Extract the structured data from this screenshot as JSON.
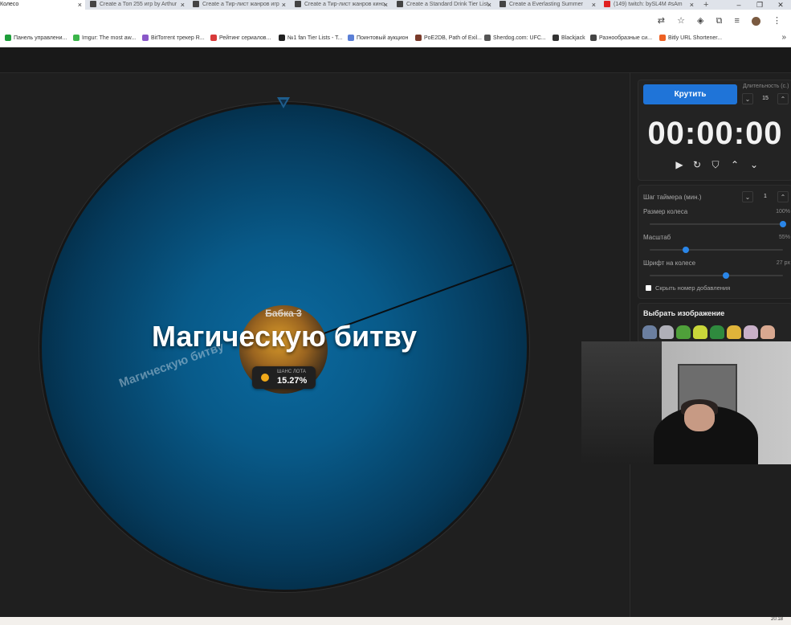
{
  "browser": {
    "tabs": [
      {
        "label": "Колесо",
        "active": true
      },
      {
        "label": "Create a Топ 255 игр by Arthur"
      },
      {
        "label": "Create a Тир-лист жанров игр"
      },
      {
        "label": "Create a Тир-лист жанров кино"
      },
      {
        "label": "Create a Standard Drink Tier List"
      },
      {
        "label": "Create a Everlasting Summer"
      },
      {
        "label": "(149) twitch: bySL4M #sAm"
      }
    ],
    "bookmarks": [
      {
        "label": "Панель управлени...",
        "color": "#1e9e3a"
      },
      {
        "label": "Imgur: The most aw...",
        "color": "#3bb54a"
      },
      {
        "label": "BitTorrent трекер R...",
        "color": "#8a58c8"
      },
      {
        "label": "Рейтинг сериалов...",
        "color": "#d83a3a"
      },
      {
        "label": "№1 fan Tier Lists - T...",
        "color": "#222222"
      },
      {
        "label": "Поинтовый аукцион",
        "color": "#5b7fd6"
      },
      {
        "label": "PoE2DB, Path of Exil...",
        "color": "#7a3b2a"
      },
      {
        "label": "Sherdog.com: UFC...",
        "color": "#555555"
      },
      {
        "label": "Blackjack",
        "color": "#333333"
      },
      {
        "label": "Разнообразные си...",
        "color": "#444444"
      },
      {
        "label": "Bitly URL Shortener...",
        "color": "#ee6123"
      }
    ]
  },
  "wheel": {
    "winner_label": "Магическую битву",
    "segment_label": "Магическую битву",
    "center_name": "Бабка 3",
    "chance_label": "ШАНС ЛОТА",
    "chance_value": "15.27%"
  },
  "controls": {
    "spin_label": "Крутить",
    "duration_label": "Длительность (с.)",
    "duration_value": "15",
    "timer": "00:00:00",
    "timer_step_label": "Шаг таймера (мин.)",
    "timer_step_value": "1",
    "wheel_size_label": "Размер колеса",
    "wheel_size_value": "100%",
    "wheel_size_fraction": 1.0,
    "scale_label": "Масштаб",
    "scale_value": "55%",
    "scale_fraction": 0.27,
    "font_label": "Шрифт на колесе",
    "font_value": "27 px",
    "font_fraction": 0.57,
    "hide_number_label": "Скрыть номер добавления",
    "image_title": "Выбрать изображение"
  },
  "colors": {
    "accent": "#1f74d8",
    "wheel": "#0b6aa0",
    "chance_dot": "#f0a91a"
  },
  "taskbar": {
    "time": "20:18"
  }
}
